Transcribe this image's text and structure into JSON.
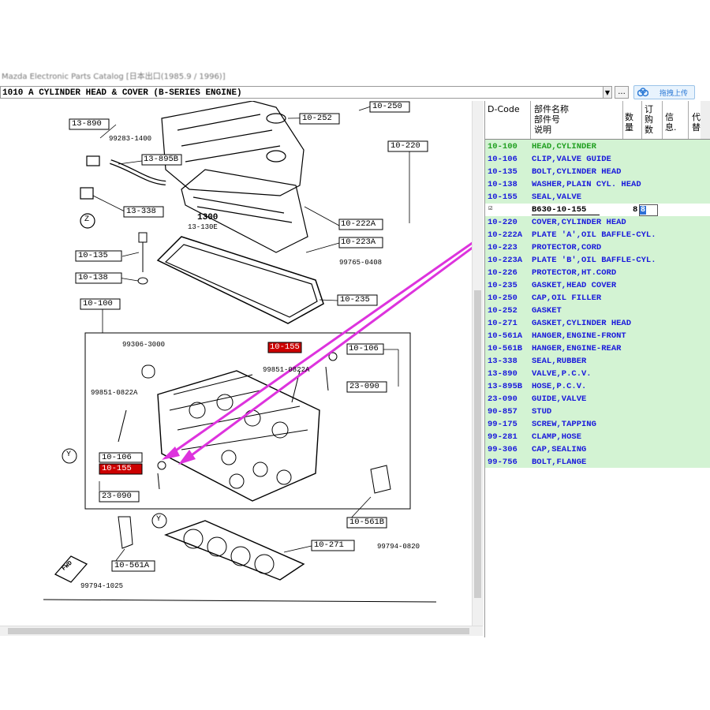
{
  "window": {
    "title": "Mazda Electronic Parts Catalog [日本出口(1985.9 / 1996)]"
  },
  "toolbar": {
    "combo_value": "1010 A  CYLINDER HEAD & COVER (B-SERIES ENGINE)",
    "combo_arrow": "▼",
    "more_label": "...",
    "upload_label": "拖拽上传"
  },
  "parts_header": {
    "code": "D-Code",
    "name": "部件名称\n部件号\n说明",
    "qty": "数\n量",
    "order": "订\n购\n数",
    "info": "信\n息.",
    "replace": "代\n替"
  },
  "parts": [
    {
      "code": "10-100",
      "desc": "HEAD,CYLINDER"
    },
    {
      "code": "10-106",
      "desc": "CLIP,VALVE GUIDE"
    },
    {
      "code": "10-135",
      "desc": "BOLT,CYLINDER HEAD"
    },
    {
      "code": "10-138",
      "desc": "WASHER,PLAIN CYL. HEAD"
    },
    {
      "code": "10-155",
      "desc": "SEAL,VALVE"
    },
    {
      "code": "10-220",
      "desc": "COVER,CYLINDER HEAD"
    },
    {
      "code": "10-222A",
      "desc": "PLATE 'A',OIL BAFFLE-CYL."
    },
    {
      "code": "10-223",
      "desc": "PROTECTOR,CORD"
    },
    {
      "code": "10-223A",
      "desc": "PLATE 'B',OIL BAFFLE-CYL."
    },
    {
      "code": "10-226",
      "desc": "PROTECTOR,HT.CORD"
    },
    {
      "code": "10-235",
      "desc": "GASKET,HEAD COVER"
    },
    {
      "code": "10-250",
      "desc": "CAP,OIL FILLER"
    },
    {
      "code": "10-252",
      "desc": "GASKET"
    },
    {
      "code": "10-271",
      "desc": "GASKET,CYLINDER HEAD"
    },
    {
      "code": "10-561A",
      "desc": "HANGER,ENGINE-FRONT"
    },
    {
      "code": "10-561B",
      "desc": "HANGER,ENGINE-REAR"
    },
    {
      "code": "13-338",
      "desc": "SEAL,RUBBER"
    },
    {
      "code": "13-890",
      "desc": "VALVE,P.C.V."
    },
    {
      "code": "13-895B",
      "desc": "HOSE,P.C.V."
    },
    {
      "code": "23-090",
      "desc": "GUIDE,VALVE"
    },
    {
      "code": "90-857",
      "desc": "STUD"
    },
    {
      "code": "99-175",
      "desc": "SCREW,TAPPING"
    },
    {
      "code": "99-281",
      "desc": "CLAMP,HOSE"
    },
    {
      "code": "99-306",
      "desc": "CAP,SEALING"
    },
    {
      "code": "99-756",
      "desc": "BOLT,FLANGE"
    }
  ],
  "edit_row": {
    "check": "☑",
    "part_number": "B630-10-155",
    "qty": "8",
    "order_qty": "8"
  },
  "diagram": {
    "callouts": [
      "10-250",
      "10-252",
      "13-890",
      "13-895B",
      "13-338",
      "10-220",
      "10-222A",
      "10-223A",
      "10-135",
      "10-138",
      "10-235",
      "10-100",
      "10-155",
      "10-106",
      "23-090",
      "10-106",
      "10-155",
      "23-090",
      "10-561B",
      "10-271",
      "10-561A"
    ],
    "numbers": [
      "99283-1400",
      "1300",
      "13-130E",
      "99765-0408",
      "99306-3000",
      "99851-0822A",
      "99851-0822A",
      "99794-0820",
      "99794-1025"
    ],
    "markers": [
      "Z",
      "Y",
      "Y"
    ],
    "fwd": "FWD"
  },
  "colors": {
    "row_bg": "#d3f3d3",
    "row_text": "#1a1adc",
    "first_row_text": "#1f9f1f",
    "highlight_box": "#cc0000",
    "arrow": "#dd33dd"
  }
}
